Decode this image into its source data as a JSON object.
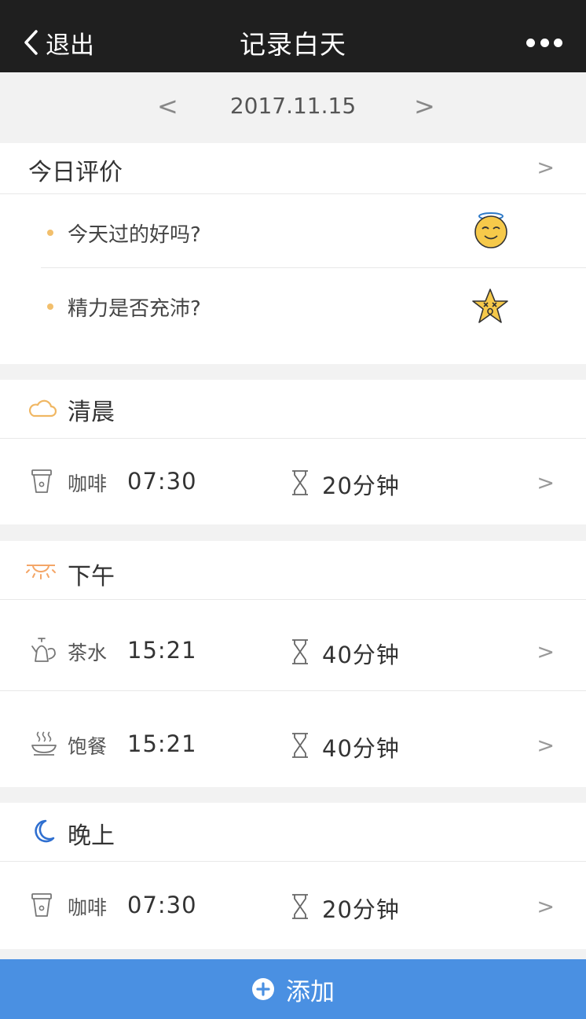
{
  "header": {
    "back_label": "退出",
    "title": "记录白天"
  },
  "date_bar": {
    "prev": "<",
    "date": "2017.11.15",
    "next": ">"
  },
  "evaluation": {
    "title": "今日评价",
    "chevron": ">",
    "items": [
      {
        "question": "今天过的好吗?",
        "icon": "angel-smiley-icon"
      },
      {
        "question": "精力是否充沛?",
        "icon": "dizzy-star-icon"
      }
    ]
  },
  "sections": [
    {
      "title": "清晨",
      "icon": "cloud-icon",
      "rows": [
        {
          "name": "咖啡",
          "time": "07:30",
          "duration": "20分钟",
          "icon": "coffee-cup-icon",
          "chevron": ">"
        }
      ]
    },
    {
      "title": "下午",
      "icon": "sun-icon",
      "rows": [
        {
          "name": "茶水",
          "time": "15:21",
          "duration": "40分钟",
          "icon": "teapot-icon",
          "chevron": ">"
        },
        {
          "name": "饱餐",
          "time": "15:21",
          "duration": "40分钟",
          "icon": "meal-bowl-icon",
          "chevron": ">"
        }
      ]
    },
    {
      "title": "晚上",
      "icon": "moon-icon",
      "rows": [
        {
          "name": "咖啡",
          "time": "07:30",
          "duration": "20分钟",
          "icon": "coffee-cup-icon",
          "chevron": ">"
        }
      ]
    }
  ],
  "add_button": {
    "label": "添加"
  },
  "colors": {
    "header_bg": "#1f1f1f",
    "accent_blue": "#4a90e2",
    "bullet": "#f2bf6c",
    "cloud": "#f0b763",
    "sun": "#f4a667",
    "moon": "#2f6fd0",
    "emoji_yellow": "#f6c94a"
  }
}
